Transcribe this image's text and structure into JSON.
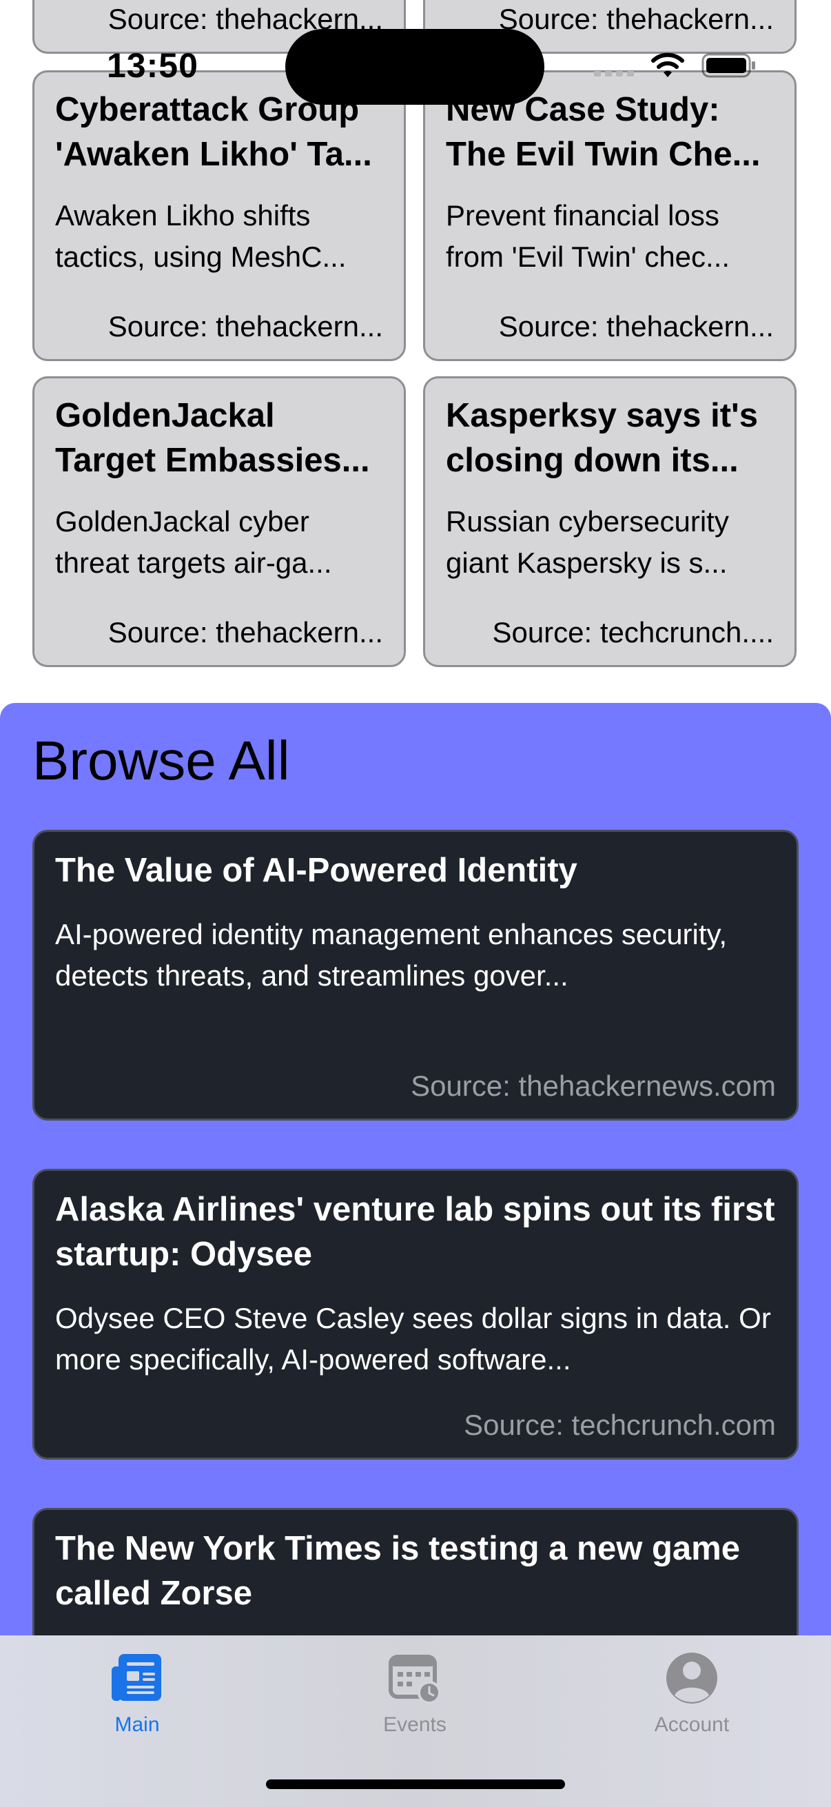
{
  "status_bar": {
    "time": "13:50"
  },
  "top_grid": {
    "partial_row": [
      {
        "source": "Source: thehackern..."
      },
      {
        "source": "Source: thehackern..."
      }
    ],
    "cards": [
      {
        "title": "Cyberattack Group 'Awaken Likho' Ta...",
        "description": "Awaken Likho shifts tactics, using MeshC...",
        "source": "Source: thehackern..."
      },
      {
        "title": "New Case Study: The Evil Twin Che...",
        "description": "Prevent financial loss from 'Evil Twin' chec...",
        "source": "Source: thehackern..."
      },
      {
        "title": "GoldenJackal Target Embassies...",
        "description": "GoldenJackal cyber threat targets air-ga...",
        "source": "Source: thehackern..."
      },
      {
        "title": "Kasperksy says it's closing down its...",
        "description": "Russian cybersecurity giant Kaspersky is s...",
        "source": "Source: techcrunch...."
      }
    ]
  },
  "browse": {
    "title": "Browse All",
    "articles": [
      {
        "title": "The Value of AI-Powered Identity",
        "description": "AI-powered identity management enhances security, detects threats, and streamlines gover...",
        "source": "Source: thehackernews.com"
      },
      {
        "title": "Alaska Airlines' venture lab spins out its first startup: Odysee",
        "description": "Odysee CEO Steve Casley sees dollar signs in data. Or more specifically, AI-powered software...",
        "source": "Source: techcrunch.com"
      },
      {
        "title": "The New York Times is testing a new game called Zorse",
        "description": "",
        "source": ""
      }
    ]
  },
  "tab_bar": {
    "tabs": [
      {
        "label": "Main",
        "icon": "newspaper-icon",
        "active": true
      },
      {
        "label": "Events",
        "icon": "calendar-clock-icon",
        "active": false
      },
      {
        "label": "Account",
        "icon": "person-circle-icon",
        "active": false
      }
    ],
    "colors": {
      "active": "#1a73e8",
      "inactive": "#8e8e93"
    }
  },
  "colors": {
    "browse_background": "#7479ff",
    "news_card_background": "#1f232b",
    "grid_card_background": "#d6d6d8"
  }
}
